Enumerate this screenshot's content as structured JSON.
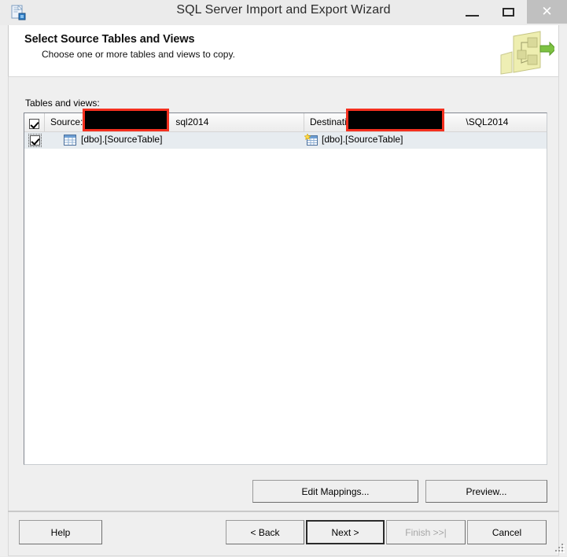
{
  "window": {
    "title": "SQL Server Import and Export Wizard",
    "icon": "wizard-document-icon",
    "controls": {
      "minimize": "–",
      "maximize": "❐",
      "close": "✕"
    }
  },
  "banner": {
    "title": "Select Source Tables and Views",
    "subtitle": "Choose one or more tables and views to copy.",
    "graphic": "data-flow-diagram-icon"
  },
  "main": {
    "tables_label": "Tables and views:",
    "listview": {
      "columns": {
        "check": "",
        "source": "Source:",
        "source_suffix": "sql2014",
        "destination": "Destination:",
        "destination_suffix": "\\SQL2014",
        "source_redacted": "",
        "destination_redacted": ""
      },
      "rows": [
        {
          "checked": true,
          "source_icon": "table-icon",
          "source": "[dbo].[SourceTable]",
          "destination_icon": "new-table-icon",
          "destination": "[dbo].[SourceTable]"
        }
      ]
    }
  },
  "actions": {
    "edit_mappings": "Edit Mappings...",
    "preview": "Preview..."
  },
  "footer": {
    "help": "Help",
    "back": "< Back",
    "next": "Next >",
    "finish": "Finish >>|",
    "cancel": "Cancel"
  },
  "colors": {
    "redaction_fill": "#000000",
    "redaction_border": "#f4301f",
    "row_selected": "#e7ecf0",
    "close_button_bg": "#c0c0c0",
    "window_bg": "#efefef"
  }
}
